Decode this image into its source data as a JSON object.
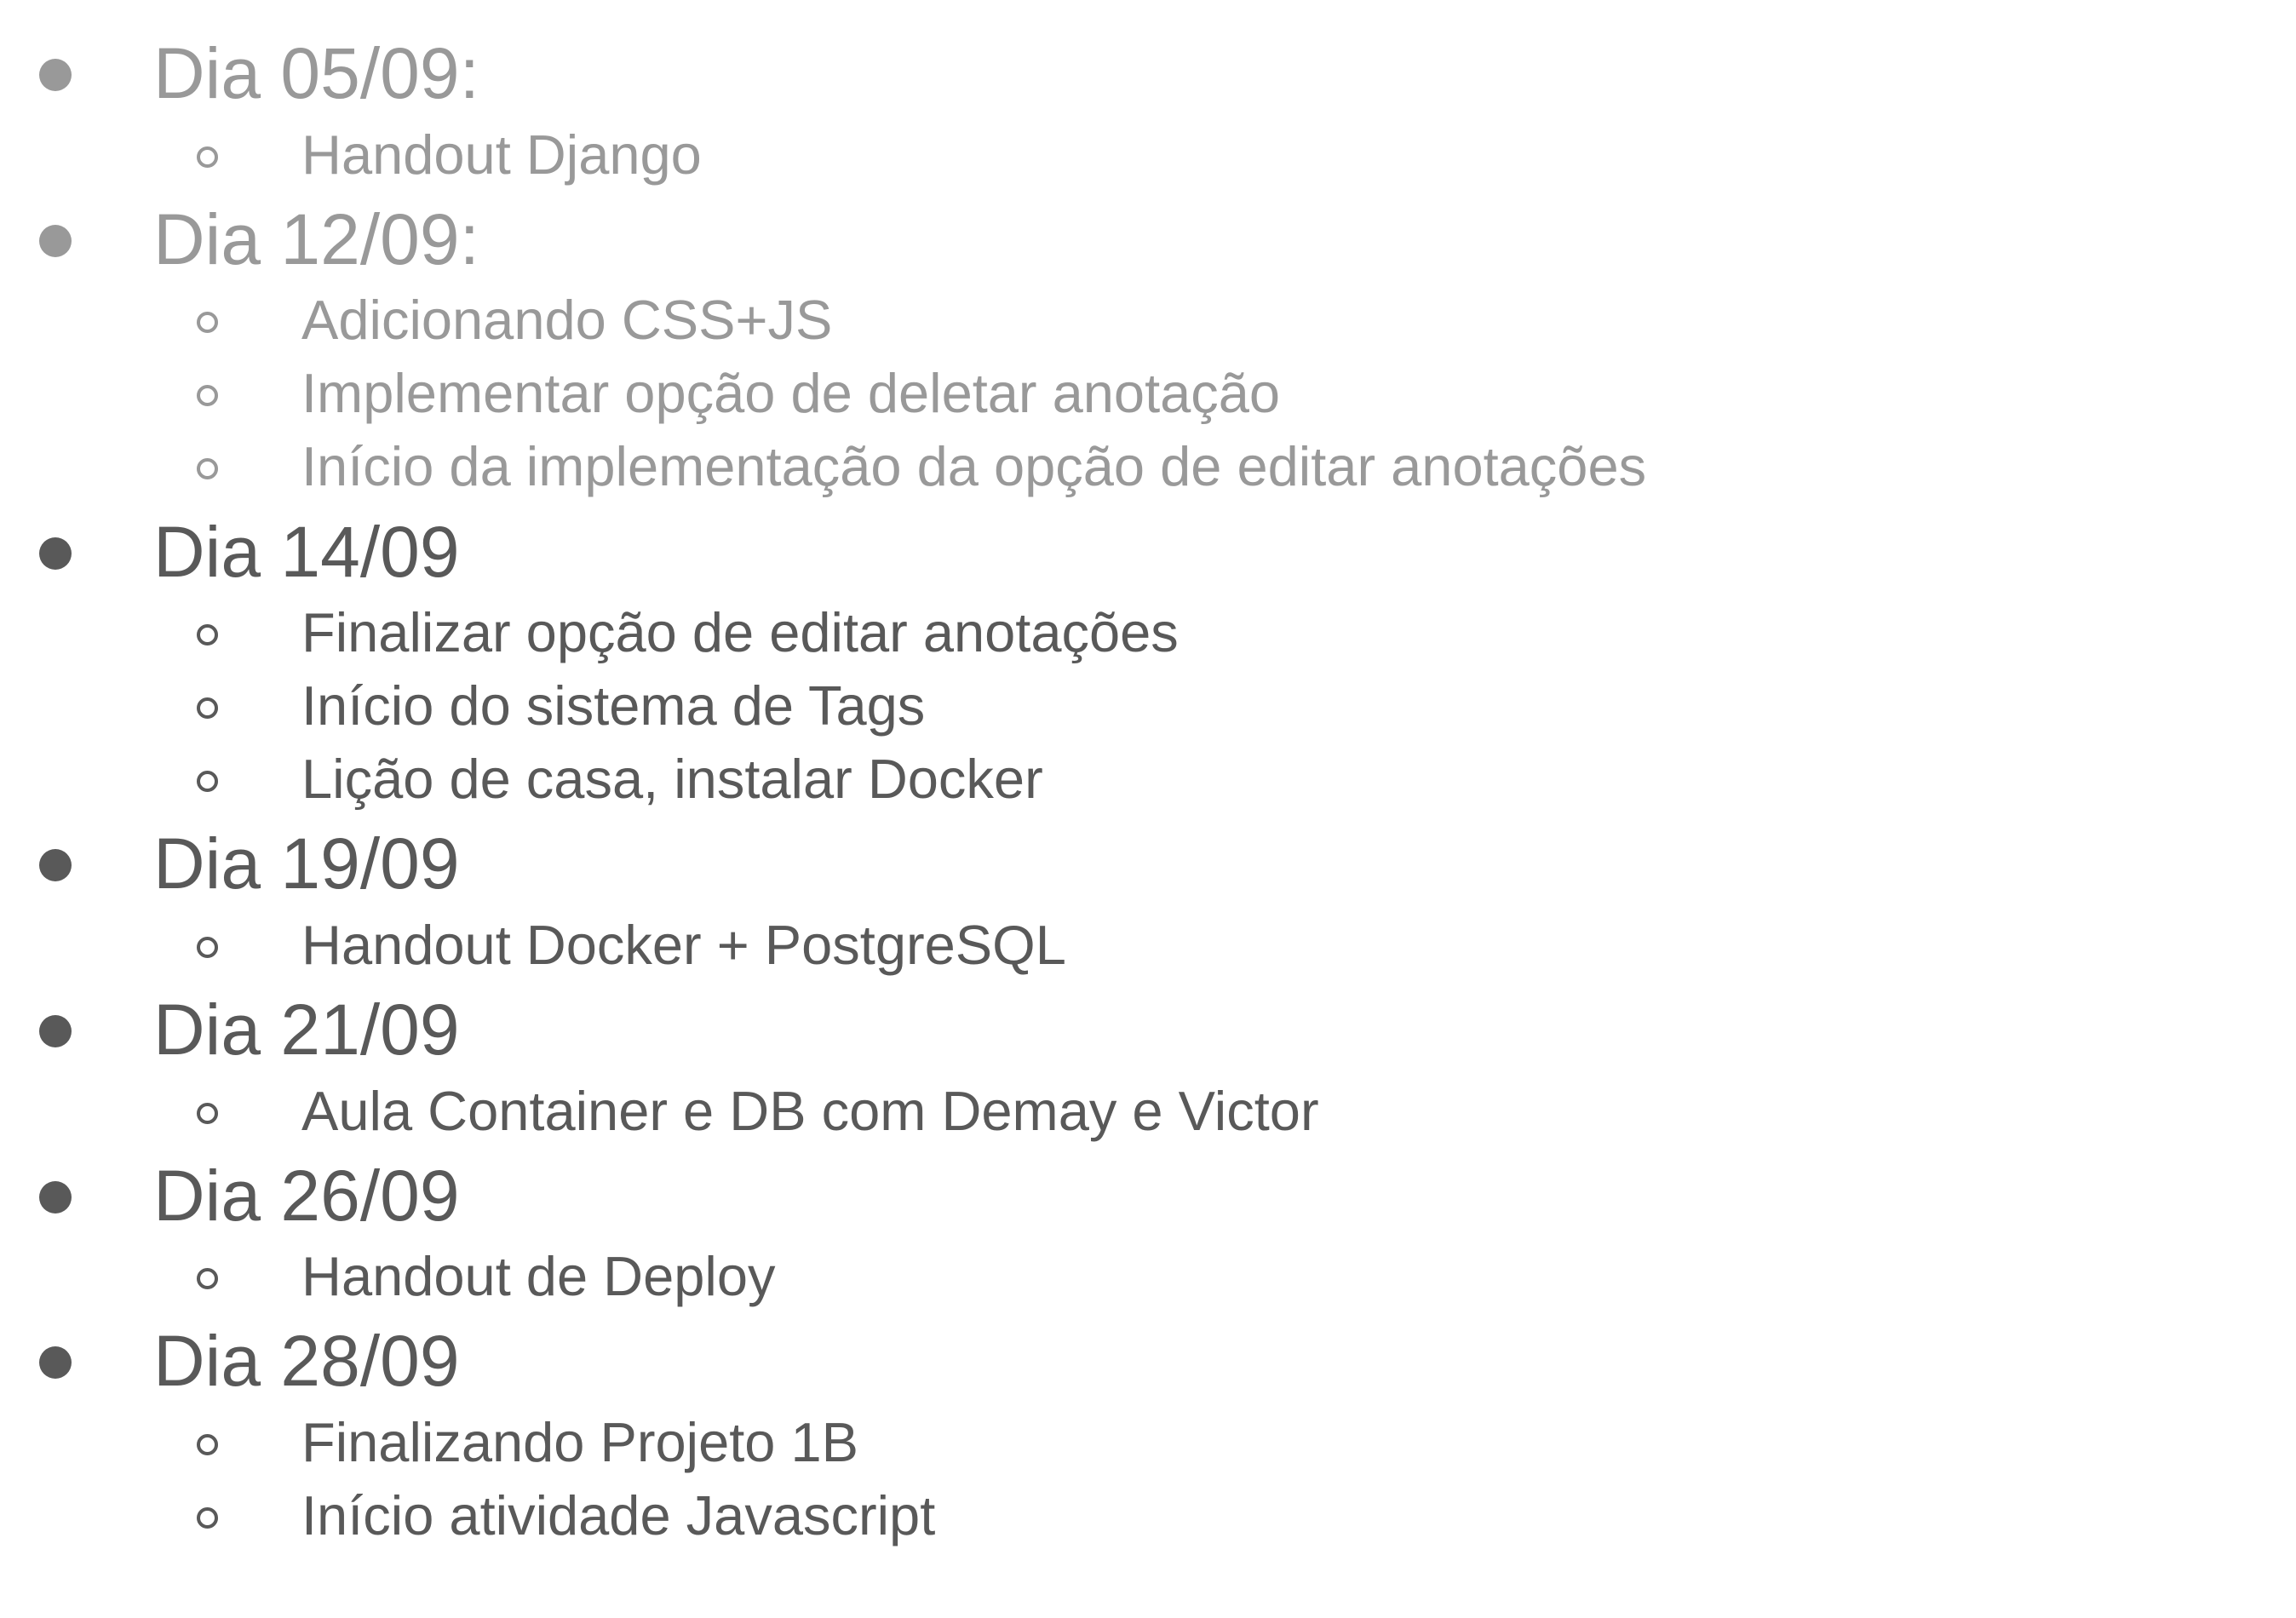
{
  "colors": {
    "past": "#999999",
    "current": "#595959"
  },
  "schedule": [
    {
      "title": "Dia 05/09:",
      "status": "past",
      "items": [
        "Handout Django"
      ]
    },
    {
      "title": "Dia 12/09:",
      "status": "past",
      "items": [
        "Adicionando CSS+JS",
        "Implementar opção de deletar anotação",
        "Início da implementação da opção de editar anotações"
      ]
    },
    {
      "title": "Dia 14/09",
      "status": "current",
      "items": [
        "Finalizar opção de editar anotações",
        "Início do sistema de Tags",
        "Lição de casa, instalar Docker"
      ]
    },
    {
      "title": "Dia 19/09",
      "status": "current",
      "items": [
        "Handout Docker + PostgreSQL"
      ]
    },
    {
      "title": "Dia 21/09",
      "status": "current",
      "items": [
        "Aula Container e DB com Demay e Victor"
      ]
    },
    {
      "title": "Dia 26/09",
      "status": "current",
      "items": [
        "Handout de Deploy"
      ]
    },
    {
      "title": "Dia 28/09",
      "status": "current",
      "items": [
        "Finalizando Projeto 1B",
        "Início atividade Javascript"
      ]
    }
  ]
}
